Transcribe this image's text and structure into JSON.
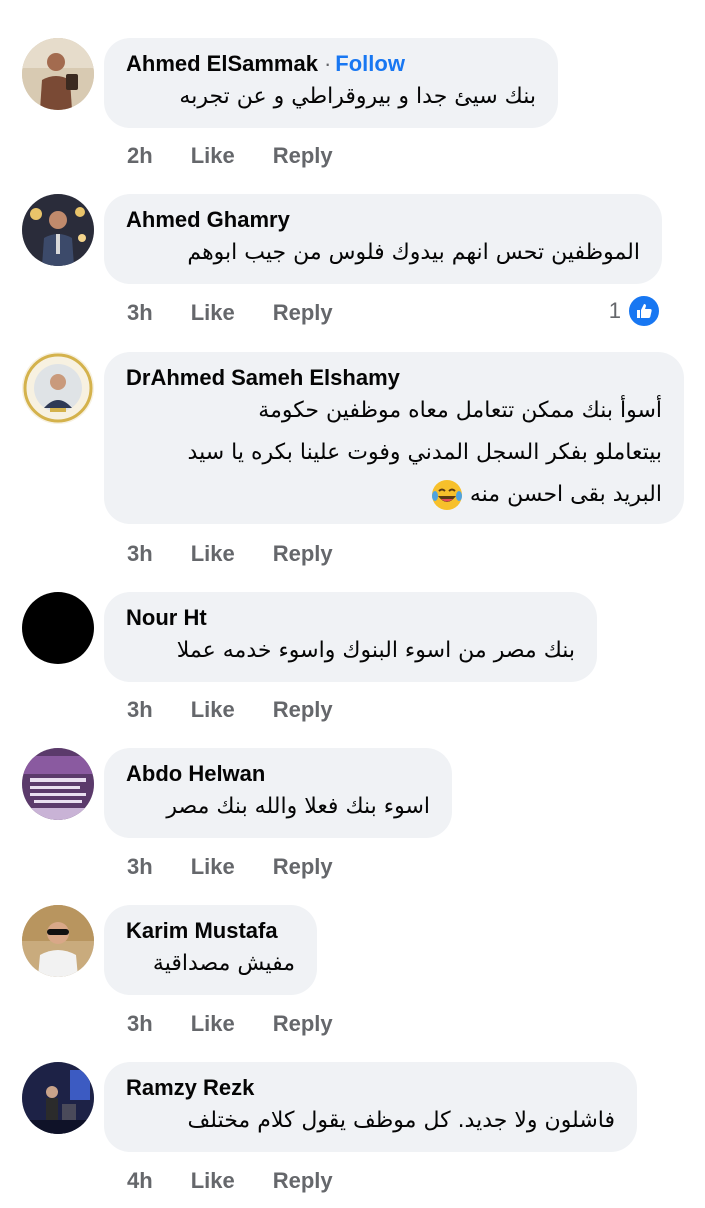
{
  "comments": [
    {
      "name": "Ahmed ElSammak",
      "follow": "Follow",
      "lines": [
        "بنك سيئ جدا و بيروقراطي و عن تجربه"
      ],
      "time": "2h",
      "like": "Like",
      "reply": "Reply"
    },
    {
      "name": "Ahmed Ghamry",
      "lines": [
        "الموظفين تحس انهم بيدوك فلوس من جيب ابوهم"
      ],
      "time": "3h",
      "like": "Like",
      "reply": "Reply",
      "reaction_count": "1",
      "reaction_icon": "like-icon"
    },
    {
      "name": "DrAhmed Sameh Elshamy",
      "lines": [
        "أسوأ بنك ممكن تتعامل معاه موظفين حكومة",
        "بيتعاملو بفكر السجل المدني وفوت علينا بكره يا سيد",
        "البريد بقى احسن منه"
      ],
      "emoji": "laughing-tears-emoji",
      "time": "3h",
      "like": "Like",
      "reply": "Reply"
    },
    {
      "name": "Nour Ht",
      "lines": [
        "بنك مصر من اسوء البنوك واسوء خدمه عملا"
      ],
      "time": "3h",
      "like": "Like",
      "reply": "Reply"
    },
    {
      "name": "Abdo Helwan",
      "lines": [
        "اسوء بنك فعلا والله بنك مصر"
      ],
      "time": "3h",
      "like": "Like",
      "reply": "Reply"
    },
    {
      "name": "Karim Mustafa",
      "lines": [
        "مفيش مصداقية"
      ],
      "time": "3h",
      "like": "Like",
      "reply": "Reply"
    },
    {
      "name": "Ramzy Rezk",
      "lines": [
        "فاشلون ولا جديد. كل موظف يقول كلام مختلف"
      ],
      "time": "4h",
      "like": "Like",
      "reply": "Reply"
    }
  ],
  "colors": {
    "accent": "#1877f2",
    "bubble": "#f0f2f5",
    "muted": "#65676b"
  }
}
